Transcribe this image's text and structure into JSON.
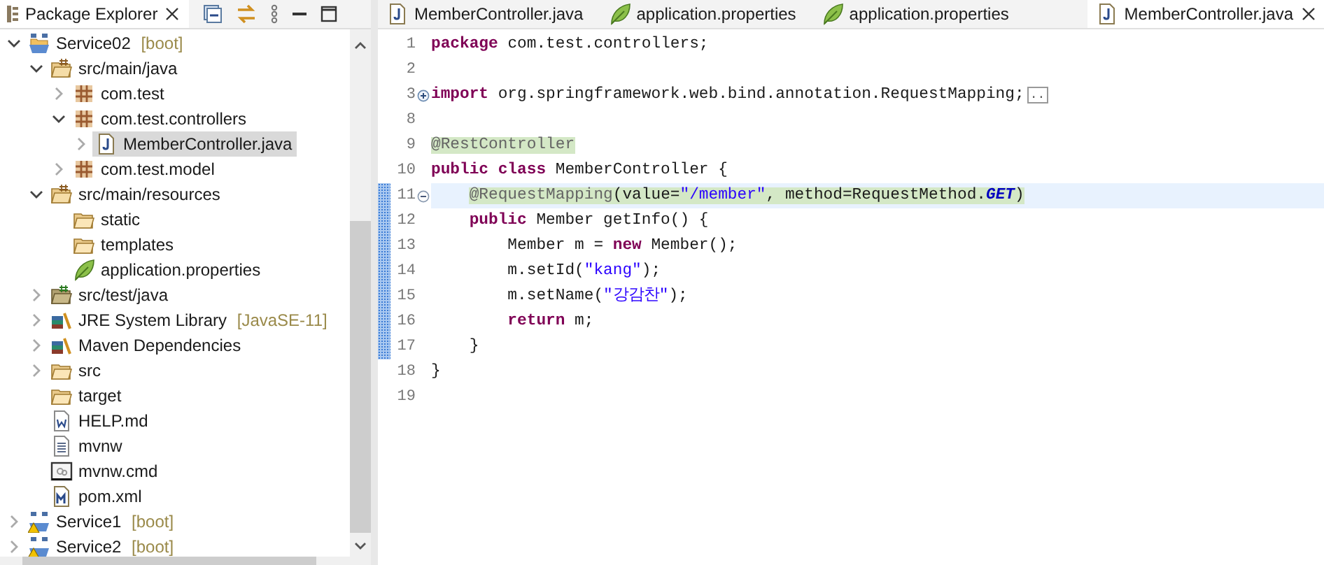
{
  "explorer": {
    "title": "Package Explorer",
    "tree": [
      {
        "label": "Service02",
        "decoration": "[boot]",
        "kind": "project",
        "expanded": true,
        "selected": false,
        "children": [
          {
            "label": "src/main/java",
            "kind": "source-folder",
            "expanded": true,
            "selected": false,
            "children": [
              {
                "label": "com.test",
                "kind": "package",
                "expanded": false,
                "selected": false
              },
              {
                "label": "com.test.controllers",
                "kind": "package",
                "expanded": true,
                "selected": false,
                "children": [
                  {
                    "label": "MemberController.java",
                    "kind": "java-file",
                    "expanded": false,
                    "selected": true
                  }
                ]
              },
              {
                "label": "com.test.model",
                "kind": "package",
                "expanded": false,
                "selected": false
              }
            ]
          },
          {
            "label": "src/main/resources",
            "kind": "source-folder",
            "expanded": true,
            "selected": false,
            "children": [
              {
                "label": "static",
                "kind": "folder",
                "selected": false
              },
              {
                "label": "templates",
                "kind": "folder",
                "selected": false
              },
              {
                "label": "application.properties",
                "kind": "properties",
                "selected": false
              }
            ]
          },
          {
            "label": "src/test/java",
            "kind": "test-folder",
            "expanded": false,
            "selected": false
          },
          {
            "label": "JRE System Library",
            "decoration": "[JavaSE-11]",
            "kind": "library",
            "expanded": false,
            "selected": false
          },
          {
            "label": "Maven Dependencies",
            "kind": "library",
            "expanded": false,
            "selected": false
          },
          {
            "label": "src",
            "kind": "folder",
            "expanded": false,
            "selected": false
          },
          {
            "label": "target",
            "kind": "folder",
            "selected": false
          },
          {
            "label": "HELP.md",
            "kind": "doc-file",
            "selected": false
          },
          {
            "label": "mvnw",
            "kind": "text-file",
            "selected": false
          },
          {
            "label": "mvnw.cmd",
            "kind": "cmd-file",
            "selected": false
          },
          {
            "label": "pom.xml",
            "kind": "maven-file",
            "selected": false
          }
        ]
      },
      {
        "label": "Service1",
        "decoration": "[boot]",
        "kind": "project-warning",
        "expanded": false,
        "selected": false
      },
      {
        "label": "Service2",
        "decoration": "[boot]",
        "kind": "project-warning",
        "expanded": false,
        "selected": false
      }
    ]
  },
  "editor": {
    "tabs": [
      {
        "label": "MemberController.java",
        "kind": "java-file",
        "selected": false
      },
      {
        "label": "application.properties",
        "kind": "properties",
        "selected": false
      },
      {
        "label": "application.properties",
        "kind": "properties",
        "selected": false
      },
      {
        "label": "MemberController.java",
        "kind": "java-file",
        "selected": true
      }
    ],
    "lines": [
      {
        "number": "1",
        "kind": "plain",
        "changed": false,
        "current": false,
        "marked": false,
        "tokens": [
          {
            "kind": "keyword",
            "t": "package"
          },
          {
            "kind": "plain",
            "t": " com.test.controllers;"
          }
        ]
      },
      {
        "number": "2",
        "kind": "plain",
        "changed": false,
        "current": false,
        "marked": false
      },
      {
        "number": "3",
        "kind": "folded",
        "changed": false,
        "current": false,
        "marked": false,
        "tokens": [
          {
            "kind": "keyword",
            "t": "import"
          },
          {
            "kind": "plain",
            "t": " org.springframework.web.bind.annotation.RequestMapping;"
          },
          {
            "kind": "fold-marker",
            "t": ".."
          }
        ]
      },
      {
        "number": "8",
        "kind": "plain",
        "changed": false,
        "current": false,
        "marked": false
      },
      {
        "number": "9",
        "kind": "plain",
        "changed": false,
        "current": false,
        "marked": true,
        "tokens": [
          {
            "kind": "annotation",
            "t": "@RestController"
          }
        ]
      },
      {
        "number": "10",
        "kind": "plain",
        "changed": false,
        "current": false,
        "marked": false,
        "tokens": [
          {
            "kind": "keyword",
            "t": "public class"
          },
          {
            "kind": "plain",
            "t": " MemberController {"
          }
        ]
      },
      {
        "number": "11",
        "kind": "foldable",
        "changed": true,
        "current": true,
        "marked": true,
        "tokens": [
          {
            "kind": "annotation",
            "t": "    @RequestMapping"
          },
          {
            "kind": "plain",
            "t": "(value="
          },
          {
            "kind": "string",
            "t": "\"/member\""
          },
          {
            "kind": "plain",
            "t": ", method=RequestMethod."
          },
          {
            "kind": "constant",
            "t": "GET"
          },
          {
            "kind": "plain",
            "t": ")"
          }
        ]
      },
      {
        "number": "12",
        "kind": "plain",
        "changed": true,
        "current": false,
        "marked": false,
        "tokens": [
          {
            "kind": "keyword",
            "t": "    public"
          },
          {
            "kind": "plain",
            "t": " Member getInfo() {"
          }
        ]
      },
      {
        "number": "13",
        "kind": "plain",
        "changed": true,
        "current": false,
        "marked": false,
        "tokens": [
          {
            "kind": "plain",
            "t": "        Member m = "
          },
          {
            "kind": "keyword",
            "t": "new"
          },
          {
            "kind": "plain",
            "t": " Member();"
          }
        ]
      },
      {
        "number": "14",
        "kind": "plain",
        "changed": true,
        "current": false,
        "marked": false,
        "tokens": [
          {
            "kind": "plain",
            "t": "        m.setId("
          },
          {
            "kind": "string",
            "t": "\"kang\""
          },
          {
            "kind": "plain",
            "t": ");"
          }
        ]
      },
      {
        "number": "15",
        "kind": "plain",
        "changed": true,
        "current": false,
        "marked": false,
        "tokens": [
          {
            "kind": "plain",
            "t": "        m.setName("
          },
          {
            "kind": "string",
            "t": "\"강감찬\""
          },
          {
            "kind": "plain",
            "t": ");"
          }
        ]
      },
      {
        "number": "16",
        "kind": "plain",
        "changed": true,
        "current": false,
        "marked": false,
        "tokens": [
          {
            "kind": "keyword",
            "t": "        return"
          },
          {
            "kind": "plain",
            "t": " m;"
          }
        ]
      },
      {
        "number": "17",
        "kind": "plain",
        "changed": true,
        "current": false,
        "marked": false,
        "tokens": [
          {
            "kind": "plain",
            "t": "    }"
          }
        ]
      },
      {
        "number": "18",
        "kind": "plain",
        "changed": false,
        "current": false,
        "marked": false,
        "tokens": [
          {
            "kind": "plain",
            "t": "}"
          }
        ]
      },
      {
        "number": "19",
        "kind": "plain",
        "changed": false,
        "current": false,
        "marked": false
      }
    ]
  }
}
